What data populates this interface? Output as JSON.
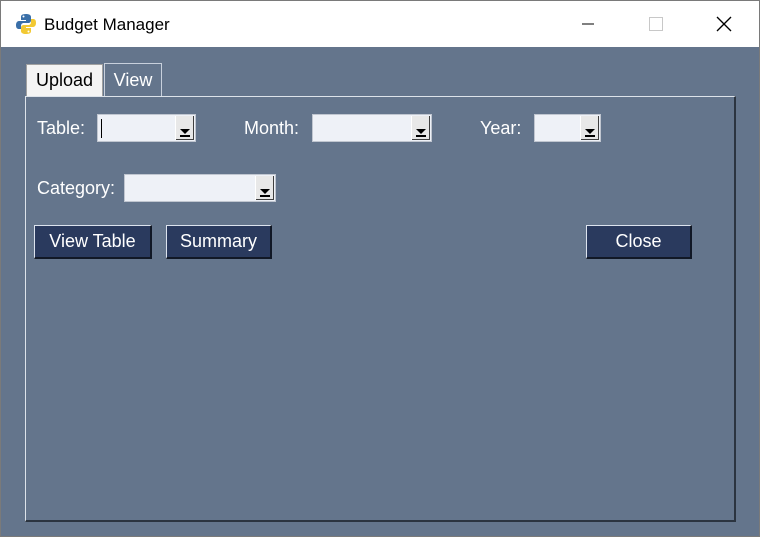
{
  "window": {
    "title": "Budget Manager",
    "controls": {
      "minimize": "minimize-icon",
      "maximize": "maximize-icon",
      "close": "close-icon"
    }
  },
  "tabs": [
    {
      "label": "Upload",
      "selected": false
    },
    {
      "label": "View",
      "selected": true
    }
  ],
  "filters": {
    "table": {
      "label": "Table:",
      "value": ""
    },
    "month": {
      "label": "Month:",
      "value": ""
    },
    "year": {
      "label": "Year:",
      "value": ""
    },
    "category": {
      "label": "Category:",
      "value": ""
    }
  },
  "buttons": {
    "view_table": "View Table",
    "summary": "Summary",
    "close": "Close"
  },
  "colors": {
    "panel_bg": "#64758c",
    "button_bg": "#2a3a5e"
  }
}
